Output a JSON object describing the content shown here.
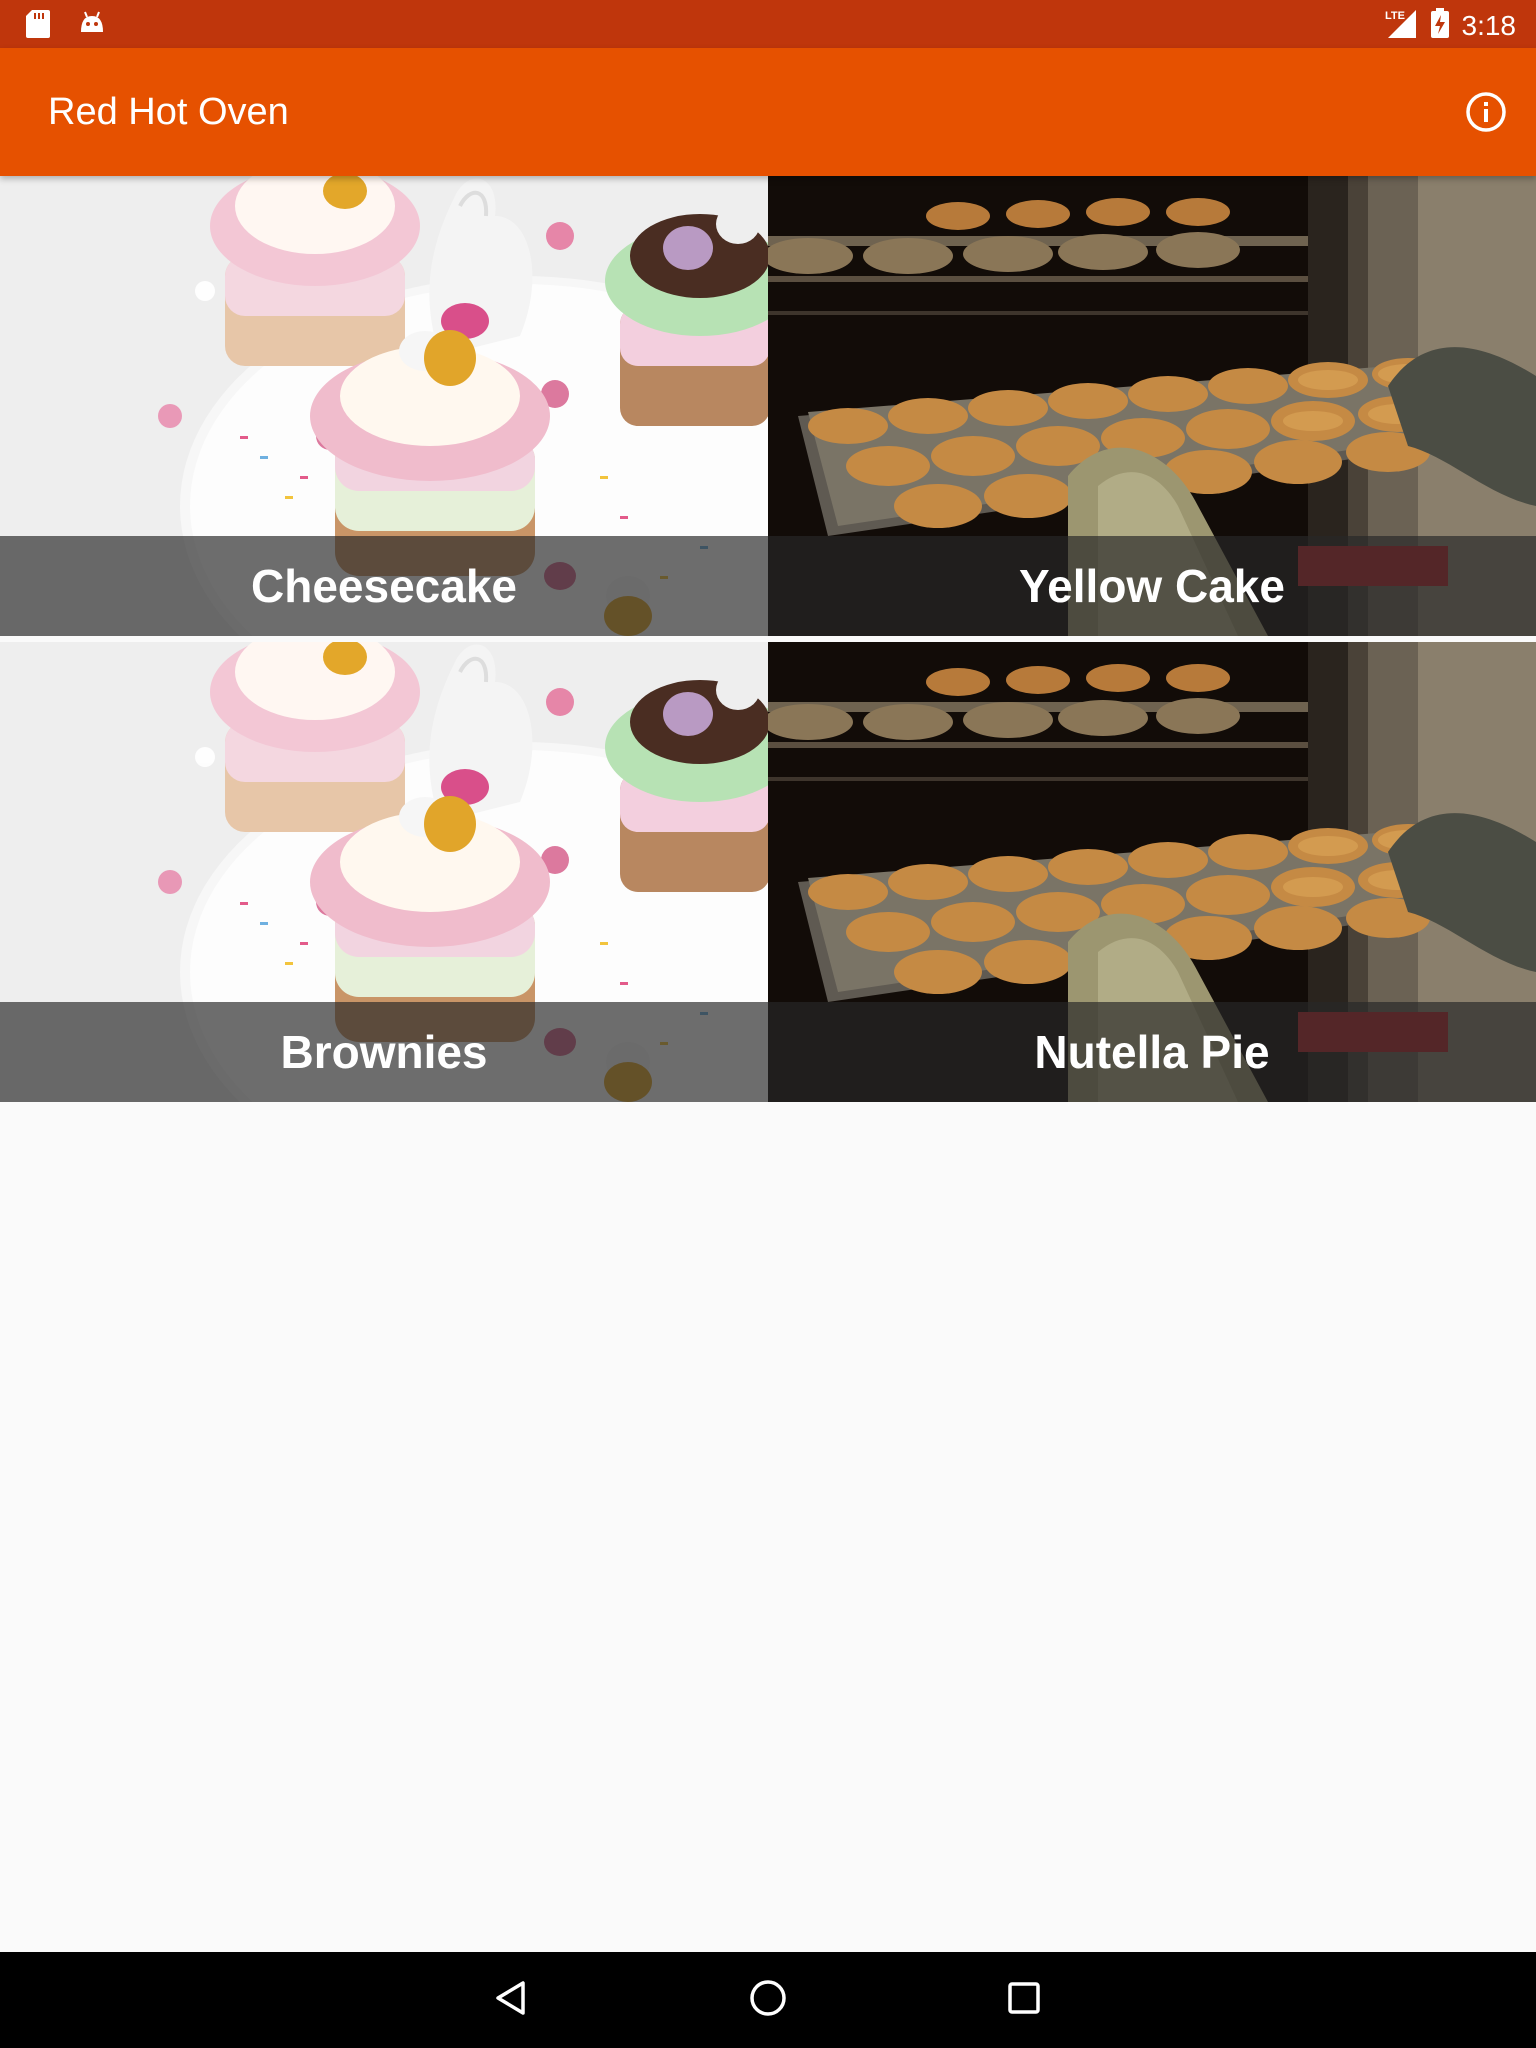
{
  "status_bar": {
    "time": "3:18",
    "network": "LTE",
    "icons": [
      "sd-card-icon",
      "android-icon",
      "signal-icon",
      "battery-charging-icon"
    ]
  },
  "app_bar": {
    "title": "Red Hot Oven",
    "action_icon": "info-icon"
  },
  "recipes": [
    {
      "name": "Cheesecake",
      "photo": "easter-cupcakes"
    },
    {
      "name": "Yellow Cake",
      "photo": "muffins-in-oven"
    },
    {
      "name": "Brownies",
      "photo": "easter-cupcakes"
    },
    {
      "name": "Nutella Pie",
      "photo": "muffins-in-oven"
    }
  ],
  "nav_bar": {
    "icons": [
      "back-icon",
      "home-icon",
      "recents-icon"
    ]
  },
  "colors": {
    "status_bar": "#bf360c",
    "app_bar": "#e65100",
    "background": "#fafafa"
  }
}
